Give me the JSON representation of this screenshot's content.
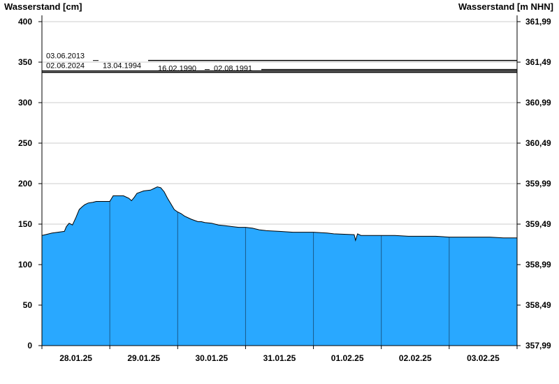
{
  "chart_data": {
    "type": "area",
    "ylabel_left": "Wasserstand [cm]",
    "ylabel_right": "Wasserstand [m NHN]",
    "ylim": [
      0,
      400
    ],
    "grid": true,
    "colors": {
      "fill": "#29A8FF",
      "outline": "#000000",
      "grid": "#cccccc",
      "divider": "#1a5a8a"
    },
    "y_ticks_left": [
      "0",
      "50",
      "100",
      "150",
      "200",
      "250",
      "300",
      "350",
      "400"
    ],
    "y_ticks_right": [
      "357,99",
      "358,49",
      "358,99",
      "359,49",
      "359,99",
      "360,49",
      "360,99",
      "361,49",
      "361,99"
    ],
    "x_tick_labels": [
      "28.01.25",
      "29.01.25",
      "30.01.25",
      "31.01.25",
      "01.02.25",
      "02.02.25",
      "03.02.25"
    ],
    "x_range_days": [
      0,
      7
    ],
    "series": [
      {
        "x": [
          0,
          0.05,
          0.15,
          0.33,
          0.36,
          0.4,
          0.45,
          0.5,
          0.55,
          0.6,
          0.63,
          0.68,
          0.75,
          0.8,
          0.9,
          1.0,
          1.05,
          1.1,
          1.2,
          1.28,
          1.32,
          1.36,
          1.4,
          1.5,
          1.6,
          1.65,
          1.7,
          1.75,
          1.8,
          1.85,
          1.9,
          1.95,
          2.0,
          2.05,
          2.1,
          2.2,
          2.3,
          2.35,
          2.4,
          2.5,
          2.6,
          2.7,
          2.8,
          2.9,
          3.0,
          3.1,
          3.2,
          3.3,
          3.5,
          3.7,
          3.8,
          4.0,
          4.2,
          4.3,
          4.6,
          4.62,
          4.65,
          4.7,
          4.8,
          5.0,
          5.2,
          5.4,
          5.5,
          5.6,
          5.8,
          6.0,
          6.2,
          6.4,
          6.6,
          6.8,
          7.0
        ],
        "y": [
          136,
          137,
          139,
          141,
          147,
          151,
          149,
          158,
          168,
          172,
          174,
          176,
          177,
          178,
          178,
          178,
          185,
          185,
          185,
          182,
          179,
          183,
          188,
          191,
          192,
          194,
          196,
          195,
          190,
          182,
          175,
          168,
          165,
          163,
          160,
          156,
          153,
          153,
          152,
          151,
          149,
          148,
          147,
          146,
          146,
          145,
          143,
          142,
          141,
          140,
          140,
          140,
          139,
          138,
          137,
          130,
          138,
          136,
          136,
          136,
          136,
          135,
          135,
          135,
          135,
          134,
          134,
          134,
          134,
          133,
          133
        ]
      }
    ],
    "reference_lines": [
      {
        "label": "03.06.2013",
        "value": 352
      },
      {
        "label": "02.06.2024",
        "value": 340
      },
      {
        "label": "13.04.1994",
        "value": 339
      },
      {
        "label": "16.02.1990",
        "value": 338
      },
      {
        "label": "02.08.1991",
        "value": 337
      }
    ]
  }
}
